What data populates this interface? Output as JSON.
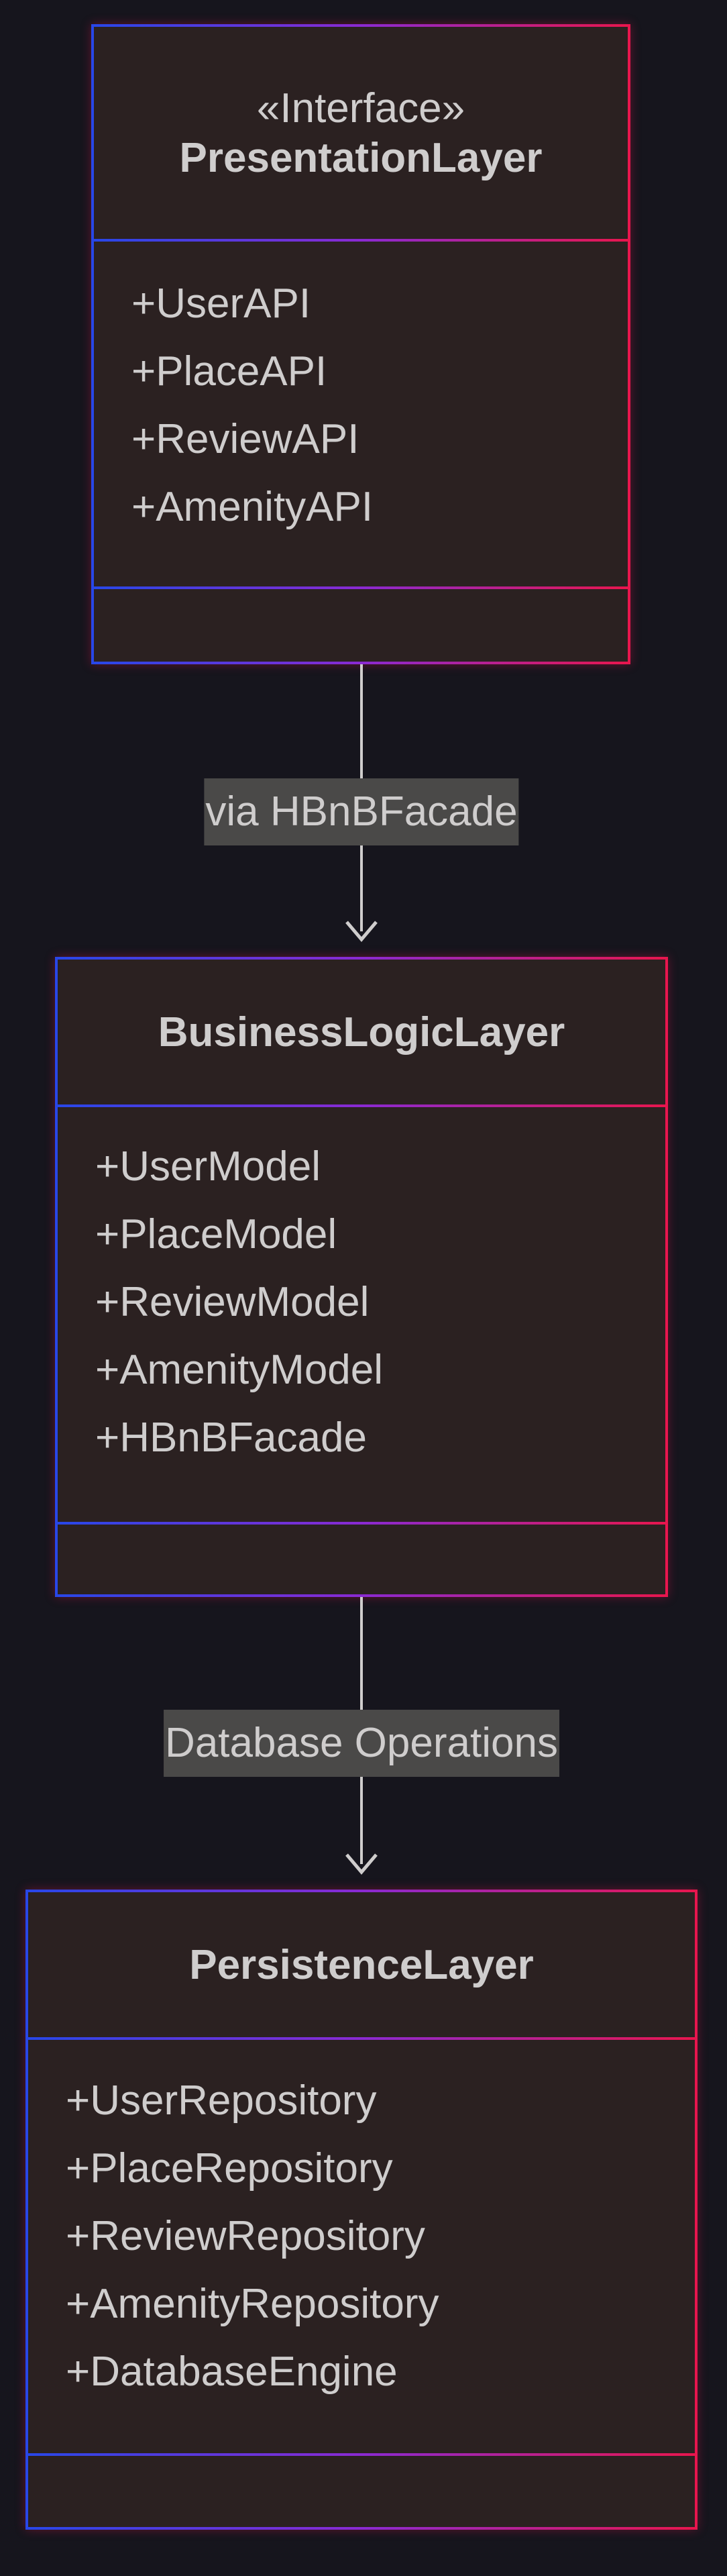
{
  "diagram": {
    "presentation_layer": {
      "stereotype": "«Interface»",
      "name": "PresentationLayer",
      "members": [
        "+UserAPI",
        "+PlaceAPI",
        "+ReviewAPI",
        "+AmenityAPI"
      ]
    },
    "business_logic_layer": {
      "name": "BusinessLogicLayer",
      "members": [
        "+UserModel",
        "+PlaceModel",
        "+ReviewModel",
        "+AmenityModel",
        "+HBnBFacade"
      ]
    },
    "persistence_layer": {
      "name": "PersistenceLayer",
      "members": [
        "+UserRepository",
        "+PlaceRepository",
        "+ReviewRepository",
        "+AmenityRepository",
        "+DatabaseEngine"
      ]
    },
    "edges": {
      "presentation_to_business": "via HBnBFacade",
      "business_to_persistence": "Database Operations"
    }
  },
  "colors": {
    "background": "#16151d",
    "box_fill": "#2b2121",
    "border_gradient_start": "#2847e8",
    "border_gradient_end": "#e8164e",
    "text": "#cfcdcd",
    "edge_label_background": "#4a4948"
  }
}
